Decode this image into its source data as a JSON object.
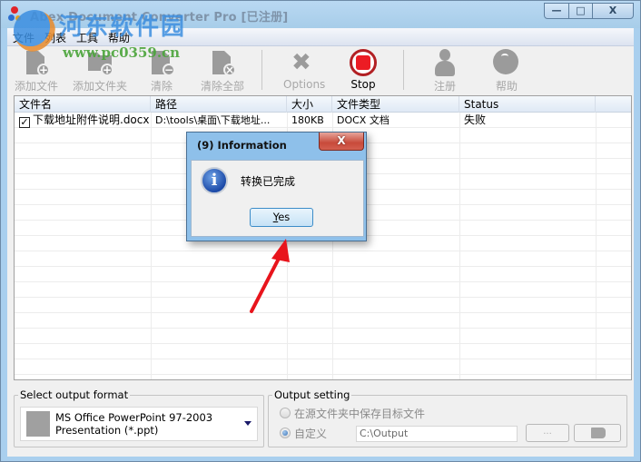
{
  "window": {
    "title": "Abex Document Converter Pro [已注册]",
    "controls": {
      "minimize": "—",
      "maximize": "□",
      "close": "X"
    }
  },
  "watermark": {
    "site_name": "河东软件园",
    "url": "www.pc0359.cn"
  },
  "menu": [
    "文件",
    "列表",
    "工具",
    "帮助"
  ],
  "toolbar": {
    "add_file": "添加文件",
    "add_folder": "添加文件夹",
    "clear": "清除",
    "clear_all": "清除全部",
    "options": "Options",
    "stop": "Stop",
    "register": "注册",
    "help": "帮助"
  },
  "file_list": {
    "columns": [
      "文件名",
      "路径",
      "大小",
      "文件类型",
      "Status"
    ],
    "rows": [
      {
        "checked": true,
        "checkmark": "✓",
        "name": "下载地址附件说明.docx",
        "path": "D:\\tools\\桌面\\下载地址...",
        "size": "180KB",
        "type": "DOCX 文档",
        "status": "失败"
      }
    ]
  },
  "output_format": {
    "group_label": "Select output format",
    "selected_line1": "MS Office PowerPoint 97-2003",
    "selected_line2": "Presentation (*.ppt)"
  },
  "output_setting": {
    "group_label": "Output setting",
    "option_source_folder": "在源文件夹中保存目标文件",
    "option_custom": "自定义",
    "selected": "custom",
    "path": "C:\\Output",
    "browse_label": "...",
    "open_folder_icon": "folder-icon"
  },
  "dialog": {
    "title": "(9)  Information",
    "close": "X",
    "icon": "information-icon",
    "icon_glyph": "i",
    "message": "转换已完成",
    "yes_mnemonic": "Y",
    "yes_rest": "es"
  },
  "annotation": {
    "arrow_color": "#e8141c"
  }
}
